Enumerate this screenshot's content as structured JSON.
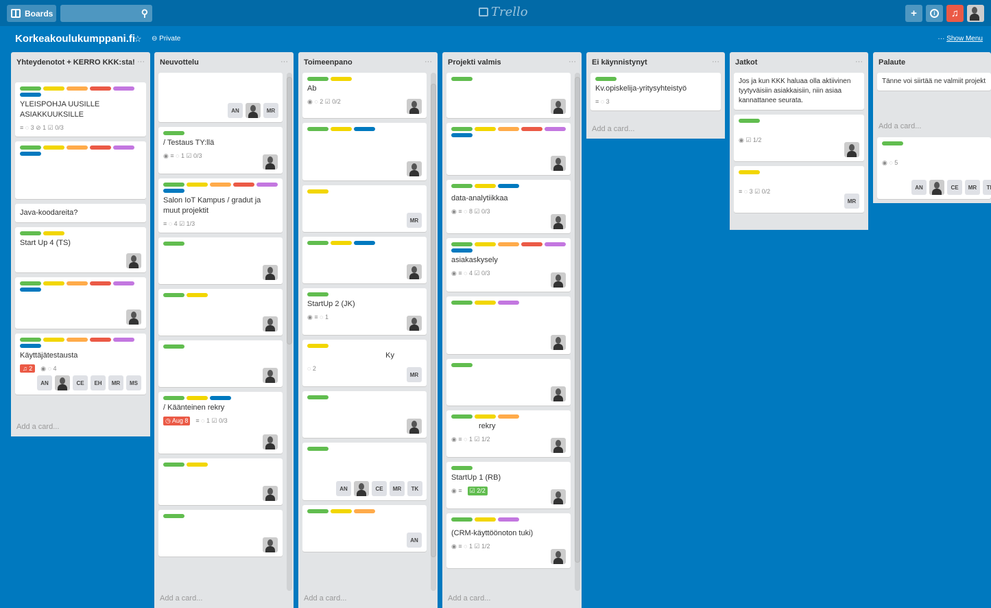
{
  "topbar": {
    "boards_label": "Boards",
    "logo": "Trello"
  },
  "board": {
    "title": "Korkeakoulukumppani.fi",
    "visibility": "Private",
    "show_menu": "Show Menu"
  },
  "add_card": "Add a card...",
  "lists": [
    {
      "title": "Yhteydenotot + KERRO KKK:sta!",
      "cards": [
        {
          "title": "YLEISPOHJA UUSILLE ASIAKKUUKSILLE",
          "badges": "≡  ◌ 3   ⊘ 1   ☑ 0/3"
        },
        {
          "title": "Java-koodareita?"
        },
        {
          "title": "Start Up 4 (TS)"
        },
        {
          "title": "Käyttäjätestausta",
          "alert": "2",
          "badges": "◉  ◌ 4"
        }
      ]
    },
    {
      "title": "Neuvottelu",
      "cards": [
        {
          "title": "/ Testaus TY:llä",
          "badges": "◉  ≡  ◌ 1  ☑ 0/3"
        },
        {
          "title": "Salon IoT Kampus / gradut ja muut projektit",
          "badges": "≡  ◌ 4  ☑ 1/3"
        },
        {
          "title": "/ Käänteinen rekry",
          "due": "Aug 8",
          "badges": "≡  ◌ 1  ☑ 0/3"
        }
      ]
    },
    {
      "title": "Toimeenpano",
      "cards": [
        {
          "title": "Ab",
          "badges": "◉  ◌ 2  ☑ 0/2"
        },
        {
          "title": "StartUp 2 (JK)",
          "badges": "◉  ≡  ◌ 1"
        },
        {
          "title": "Ky",
          "badges": "◌ 2"
        }
      ]
    },
    {
      "title": "Projekti valmis",
      "cards": [
        {
          "title": "data-analytiikkaa",
          "badges": "◉  ≡  ◌ 8  ☑ 0/3"
        },
        {
          "title": "asiakaskysely",
          "badges": "◉  ≡  ◌ 4  ☑ 0/3"
        },
        {
          "title": "rekry",
          "badges": "◉  ≡  ◌ 1  ☑ 1/2"
        },
        {
          "title": "StartUp 1 (RB)",
          "done": "2/2"
        },
        {
          "title": "(CRM-käyttöönoton tuki)",
          "badges": "◉  ≡  ◌ 1  ☑ 1/2"
        }
      ]
    },
    {
      "title": "Ei käynnistynyt",
      "cards": [
        {
          "title": "Kv.opiskelija-yritysyhteistyö",
          "badges": "≡  ◌ 3"
        }
      ]
    },
    {
      "title": "Jatkot",
      "cards": [
        {
          "title": "Jos ja kun KKK haluaa olla aktiivinen tyytyväisiin asiakkaisiin, niin asiaa kannattanee seurata."
        },
        {
          "title": "",
          "badges": "◉  ☑ 1/2"
        },
        {
          "title": "",
          "badges": "≡  ◌ 3  ☑ 0/2"
        }
      ]
    },
    {
      "title": "Palaute",
      "cards": [
        {
          "title": "Tänne voi siirtää ne valmiit projekt joiden palaute aiheuttaa jatkotoiml (hyviä tai kriittisiä)."
        },
        {
          "title": "",
          "badges": "◉  ◌ 5"
        }
      ]
    }
  ],
  "members": {
    "an": "AN",
    "ce": "CE",
    "eh": "EH",
    "mr": "MR",
    "ms": "MS",
    "tk": "TK"
  }
}
